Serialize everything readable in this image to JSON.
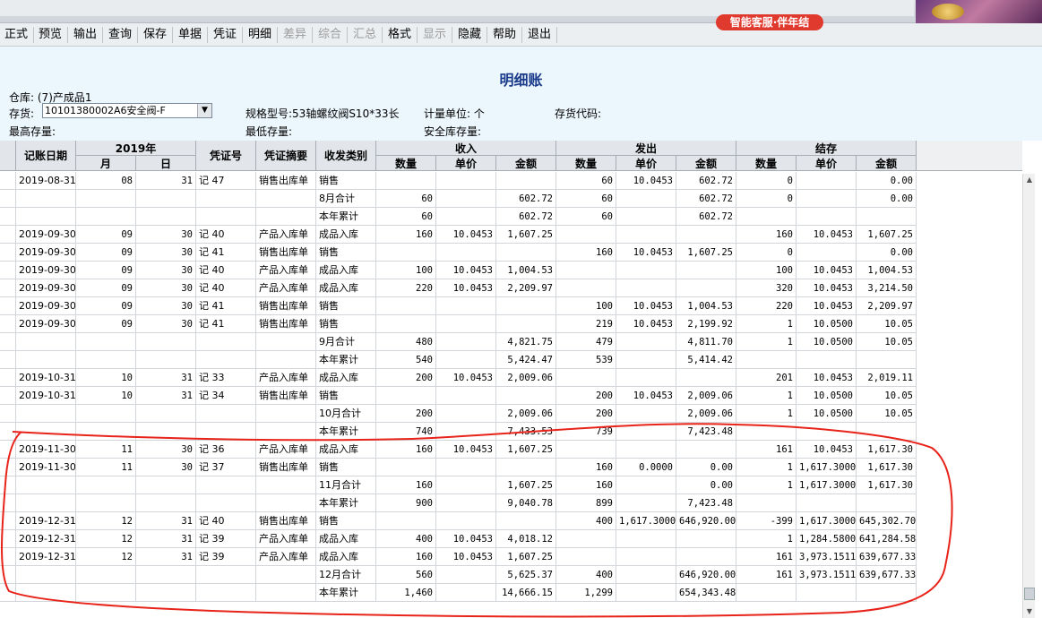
{
  "service_badge": "智能客服·伴年结",
  "toolbar": [
    {
      "label": "正式",
      "enabled": true
    },
    {
      "label": "预览",
      "enabled": true
    },
    {
      "label": "输出",
      "enabled": true
    },
    {
      "label": "查询",
      "enabled": true
    },
    {
      "label": "保存",
      "enabled": true
    },
    {
      "label": "单据",
      "enabled": true
    },
    {
      "label": "凭证",
      "enabled": true
    },
    {
      "label": "明细",
      "enabled": true
    },
    {
      "label": "差异",
      "enabled": false
    },
    {
      "label": "综合",
      "enabled": false
    },
    {
      "label": "汇总",
      "enabled": false
    },
    {
      "label": "格式",
      "enabled": true
    },
    {
      "label": "显示",
      "enabled": false
    },
    {
      "label": "隐藏",
      "enabled": true
    },
    {
      "label": "帮助",
      "enabled": true
    },
    {
      "label": "退出",
      "enabled": true
    }
  ],
  "report": {
    "title": "明细账",
    "warehouse_label": "仓库:",
    "warehouse_value": "(7)产成品1",
    "inventory_label": "存货:",
    "inventory_value": "10101380002A6安全阀-F",
    "spec_label": "规格型号:",
    "spec_value": "53轴螺纹阀S10*33长",
    "unit_label": "计量单位:",
    "unit_value": "个",
    "code_label": "存货代码:",
    "max_stock_label": "最高存量:",
    "min_stock_label": "最低存量:",
    "safety_stock_label": "安全库存量:"
  },
  "columns": {
    "date": "记账日期",
    "year": "2019年",
    "month": "月",
    "day": "日",
    "voucher_no": "凭证号",
    "summary": "凭证摘要",
    "type": "收发类别",
    "income": "收入",
    "outgo": "发出",
    "balance": "结存",
    "qty": "数量",
    "price": "单价",
    "amount": "金额"
  },
  "rows": [
    [
      "2019-08-31",
      "08",
      "31",
      "记 47",
      "销售出库单",
      "销售",
      "",
      "",
      "",
      "60",
      "10.0453",
      "602.72",
      "0",
      "",
      "0.00"
    ],
    [
      "",
      "",
      "",
      "",
      "",
      "8月合计",
      "60",
      "",
      "602.72",
      "60",
      "",
      "602.72",
      "0",
      "",
      "0.00"
    ],
    [
      "",
      "",
      "",
      "",
      "",
      "本年累计",
      "60",
      "",
      "602.72",
      "60",
      "",
      "602.72",
      "",
      "",
      ""
    ],
    [
      "2019-09-30",
      "09",
      "30",
      "记 40",
      "产品入库单",
      "成品入库",
      "160",
      "10.0453",
      "1,607.25",
      "",
      "",
      "",
      "160",
      "10.0453",
      "1,607.25"
    ],
    [
      "2019-09-30",
      "09",
      "30",
      "记 41",
      "销售出库单",
      "销售",
      "",
      "",
      "",
      "160",
      "10.0453",
      "1,607.25",
      "0",
      "",
      "0.00"
    ],
    [
      "2019-09-30",
      "09",
      "30",
      "记 40",
      "产品入库单",
      "成品入库",
      "100",
      "10.0453",
      "1,004.53",
      "",
      "",
      "",
      "100",
      "10.0453",
      "1,004.53"
    ],
    [
      "2019-09-30",
      "09",
      "30",
      "记 40",
      "产品入库单",
      "成品入库",
      "220",
      "10.0453",
      "2,209.97",
      "",
      "",
      "",
      "320",
      "10.0453",
      "3,214.50"
    ],
    [
      "2019-09-30",
      "09",
      "30",
      "记 41",
      "销售出库单",
      "销售",
      "",
      "",
      "",
      "100",
      "10.0453",
      "1,004.53",
      "220",
      "10.0453",
      "2,209.97"
    ],
    [
      "2019-09-30",
      "09",
      "30",
      "记 41",
      "销售出库单",
      "销售",
      "",
      "",
      "",
      "219",
      "10.0453",
      "2,199.92",
      "1",
      "10.0500",
      "10.05"
    ],
    [
      "",
      "",
      "",
      "",
      "",
      "9月合计",
      "480",
      "",
      "4,821.75",
      "479",
      "",
      "4,811.70",
      "1",
      "10.0500",
      "10.05"
    ],
    [
      "",
      "",
      "",
      "",
      "",
      "本年累计",
      "540",
      "",
      "5,424.47",
      "539",
      "",
      "5,414.42",
      "",
      "",
      ""
    ],
    [
      "2019-10-31",
      "10",
      "31",
      "记 33",
      "产品入库单",
      "成品入库",
      "200",
      "10.0453",
      "2,009.06",
      "",
      "",
      "",
      "201",
      "10.0453",
      "2,019.11"
    ],
    [
      "2019-10-31",
      "10",
      "31",
      "记 34",
      "销售出库单",
      "销售",
      "",
      "",
      "",
      "200",
      "10.0453",
      "2,009.06",
      "1",
      "10.0500",
      "10.05"
    ],
    [
      "",
      "",
      "",
      "",
      "",
      "10月合计",
      "200",
      "",
      "2,009.06",
      "200",
      "",
      "2,009.06",
      "1",
      "10.0500",
      "10.05"
    ],
    [
      "",
      "",
      "",
      "",
      "",
      "本年累计",
      "740",
      "",
      "7,433.53",
      "739",
      "",
      "7,423.48",
      "",
      "",
      ""
    ],
    [
      "2019-11-30",
      "11",
      "30",
      "记 36",
      "产品入库单",
      "成品入库",
      "160",
      "10.0453",
      "1,607.25",
      "",
      "",
      "",
      "161",
      "10.0453",
      "1,617.30"
    ],
    [
      "2019-11-30",
      "11",
      "30",
      "记 37",
      "销售出库单",
      "销售",
      "",
      "",
      "",
      "160",
      "0.0000",
      "0.00",
      "1",
      "1,617.3000",
      "1,617.30"
    ],
    [
      "",
      "",
      "",
      "",
      "",
      "11月合计",
      "160",
      "",
      "1,607.25",
      "160",
      "",
      "0.00",
      "1",
      "1,617.3000",
      "1,617.30"
    ],
    [
      "",
      "",
      "",
      "",
      "",
      "本年累计",
      "900",
      "",
      "9,040.78",
      "899",
      "",
      "7,423.48",
      "",
      "",
      ""
    ],
    [
      "2019-12-31",
      "12",
      "31",
      "记 40",
      "销售出库单",
      "销售",
      "",
      "",
      "",
      "400",
      "1,617.3000",
      "646,920.00",
      "-399",
      "1,617.3000",
      "645,302.70"
    ],
    [
      "2019-12-31",
      "12",
      "31",
      "记 39",
      "产品入库单",
      "成品入库",
      "400",
      "10.0453",
      "4,018.12",
      "",
      "",
      "",
      "1",
      "1,284.5800",
      "641,284.58"
    ],
    [
      "2019-12-31",
      "12",
      "31",
      "记 39",
      "产品入库单",
      "成品入库",
      "160",
      "10.0453",
      "1,607.25",
      "",
      "",
      "",
      "161",
      "3,973.1511",
      "639,677.33"
    ],
    [
      "",
      "",
      "",
      "",
      "",
      "12月合计",
      "560",
      "",
      "5,625.37",
      "400",
      "",
      "646,920.00",
      "161",
      "3,973.1511",
      "639,677.33"
    ],
    [
      "",
      "",
      "",
      "",
      "",
      "本年累计",
      "1,460",
      "",
      "14,666.15",
      "1,299",
      "",
      "654,343.48",
      "",
      "",
      ""
    ]
  ],
  "colors": {
    "header_bg": "#ecf6fd",
    "title": "#1a3a8a",
    "annotation": "#e8231a",
    "badge": "#e03a2e"
  }
}
